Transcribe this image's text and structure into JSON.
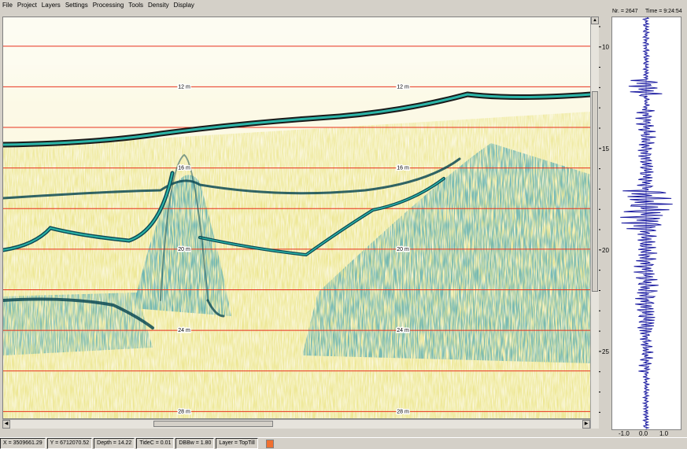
{
  "menu": [
    "File",
    "Project",
    "Layers",
    "Settings",
    "Processing",
    "Tools",
    "Density",
    "Display"
  ],
  "trace_header": {
    "nr": "Nr. = 2647",
    "time": "Time = 9:24:54"
  },
  "depth_axis": {
    "ticks": [
      "10",
      "15",
      "20",
      "25"
    ],
    "depth_range": [
      8.5,
      28.8
    ]
  },
  "depth_markers": [
    {
      "label": "12 m",
      "depth": 12
    },
    {
      "label": "16 m",
      "depth": 16
    },
    {
      "label": "20 m",
      "depth": 20
    },
    {
      "label": "24 m",
      "depth": 24
    },
    {
      "label": "28 m",
      "depth": 28
    }
  ],
  "grid_depths": [
    10,
    12,
    14,
    16,
    18,
    20,
    22,
    24,
    26,
    28
  ],
  "trace_axis": {
    "ticks": [
      "-1.0",
      "0.0",
      "1.0"
    ]
  },
  "status": {
    "x": "X = 3509661.29",
    "y": "Y = 6712070.52",
    "depth": "Depth = 14.22",
    "tidec": "TideC = 0.01",
    "dbbw": "DBBw = 1.80",
    "layer": "Layer = TopTill"
  },
  "colors": {
    "grid_line": "#e8321e",
    "trace_line": "#1a1aa0",
    "reflector_dark": "#0d4a55",
    "reflector_teal": "#2bb5a8",
    "noise_yellow": "#d9cf5a",
    "layer_swatch": "#f07030"
  }
}
